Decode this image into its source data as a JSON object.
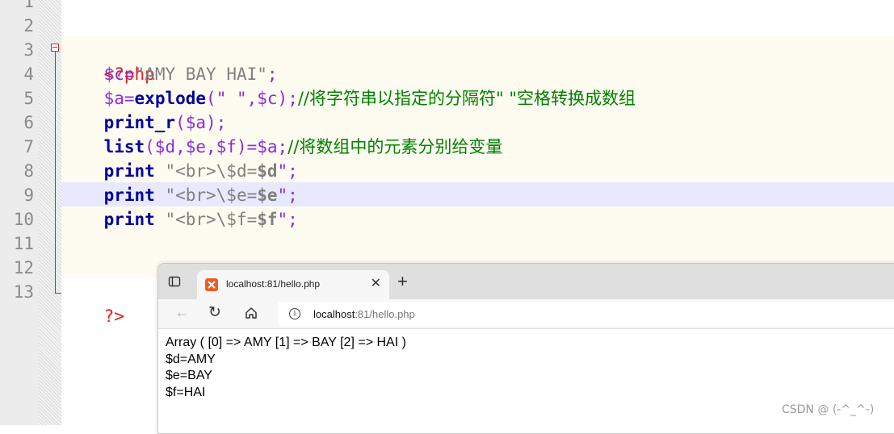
{
  "editor": {
    "line_numbers": [
      "1",
      "2",
      "3",
      "4",
      "5",
      "6",
      "7",
      "8",
      "9",
      "10",
      "11",
      "12",
      "13"
    ],
    "lines": {
      "l3": {
        "open_tag": "<?php"
      },
      "l4": {
        "var": "$c",
        "eq": "=",
        "str": "\"AMY BAY HAI\"",
        "semi": ";"
      },
      "l5": {
        "var": "$a",
        "eq": "=",
        "fn": "explode",
        "args": "(\" \",$c);",
        "comment": "//将字符串以指定的分隔符\" \"空格转换成数组"
      },
      "l6": {
        "fn": "print_r",
        "args": "($a);"
      },
      "l7": {
        "fn": "list",
        "args": "($d,$e,$f)=$a;",
        "comment": "//将数组中的元素分别给变量"
      },
      "l8": {
        "fn": "print",
        "str": " \"<br>\\$d=",
        "strb": "$d",
        "end": "\";"
      },
      "l9": {
        "fn": "print",
        "str": " \"<br>\\$e=",
        "strb": "$e",
        "end": "\";"
      },
      "l10": {
        "fn": "print",
        "str": " \"<br>\\$f=",
        "strb": "$f",
        "end": "\";"
      },
      "l13": {
        "close_tag": "?>"
      }
    }
  },
  "browser": {
    "tab_title": "localhost:81/hello.php",
    "close_glyph": "✕",
    "new_tab_glyph": "+",
    "back_glyph": "←",
    "refresh_glyph": "↻",
    "info_glyph": "i",
    "url_host": "localhost",
    "url_path": ":81/hello.php",
    "output": [
      "Array ( [0] => AMY [1] => BAY [2] => HAI )",
      "$d=AMY",
      "$e=BAY",
      "$f=HAI"
    ]
  },
  "watermark": "CSDN @  (-^_^-)",
  "colors": {
    "php_tag": "#e02020",
    "variable": "#8a2be2",
    "keyword": "#0000a0",
    "comment": "#008000",
    "string": "#808080"
  }
}
